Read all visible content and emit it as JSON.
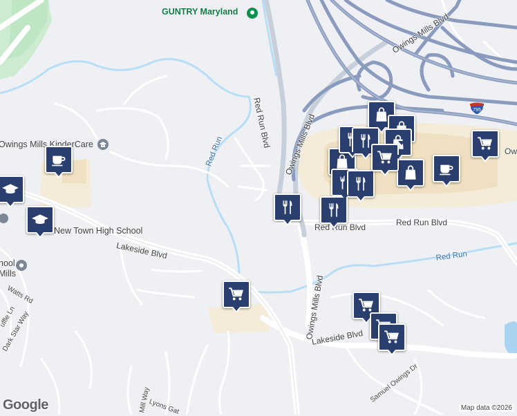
{
  "map": {
    "places": {
      "guntry": "GUNTRY Maryland",
      "kindercare": "Owings Mills KinderCare",
      "newtown_hs": "New Town High School",
      "school_mills": "hool\nMills"
    },
    "roads": {
      "red_run_blvd_north": "Red Run Blvd",
      "owings_mills_blvd_north": "Owings Mills Blvd",
      "owings_mills_blvd_south": "Owings Mills Blvd",
      "red_run_blvd_east": "Red Run Blvd",
      "red_run_blvd_west": "Red Run Blvd",
      "lakeside_blvd_west": "Lakeside Blvd",
      "lakeside_blvd_east": "Lakeside Blvd",
      "owings_mills_blvd_ne": "Owings Mills Blvd",
      "watts_rd": "Watts Rd",
      "dark_star_way": "Dark Star Way",
      "uffle_ln": "uffle Ln",
      "lyons_gate": "Lyons Gat",
      "mill_way": "Mill Way",
      "samuel_owings_dr": "Samuel Owings Dr",
      "owi_edge": "Owi"
    },
    "water": {
      "red_run_west": "Red Run",
      "red_run_east": "Red Run"
    },
    "shield": "795",
    "attribution": "Map data ©2026",
    "logo": "Google"
  },
  "pins": [
    {
      "icon": "shopping-bag"
    },
    {
      "icon": "shopping-bag"
    },
    {
      "icon": "shopping-bag"
    },
    {
      "icon": "shopping-bag"
    },
    {
      "icon": "shopping-bag"
    },
    {
      "icon": "coffee-cup"
    },
    {
      "icon": "coffee-cup"
    },
    {
      "icon": "graduation-cap"
    },
    {
      "icon": "graduation-cap"
    },
    {
      "icon": "fork-knife"
    },
    {
      "icon": "fork-knife"
    },
    {
      "icon": "fork-knife"
    },
    {
      "icon": "fork-knife"
    },
    {
      "icon": "fork-knife"
    },
    {
      "icon": "fork-knife"
    },
    {
      "icon": "shopping-cart"
    },
    {
      "icon": "shopping-cart"
    },
    {
      "icon": "shopping-cart"
    },
    {
      "icon": "shopping-cart"
    },
    {
      "icon": "shopping-cart"
    },
    {
      "icon": "shopping-cart"
    }
  ]
}
